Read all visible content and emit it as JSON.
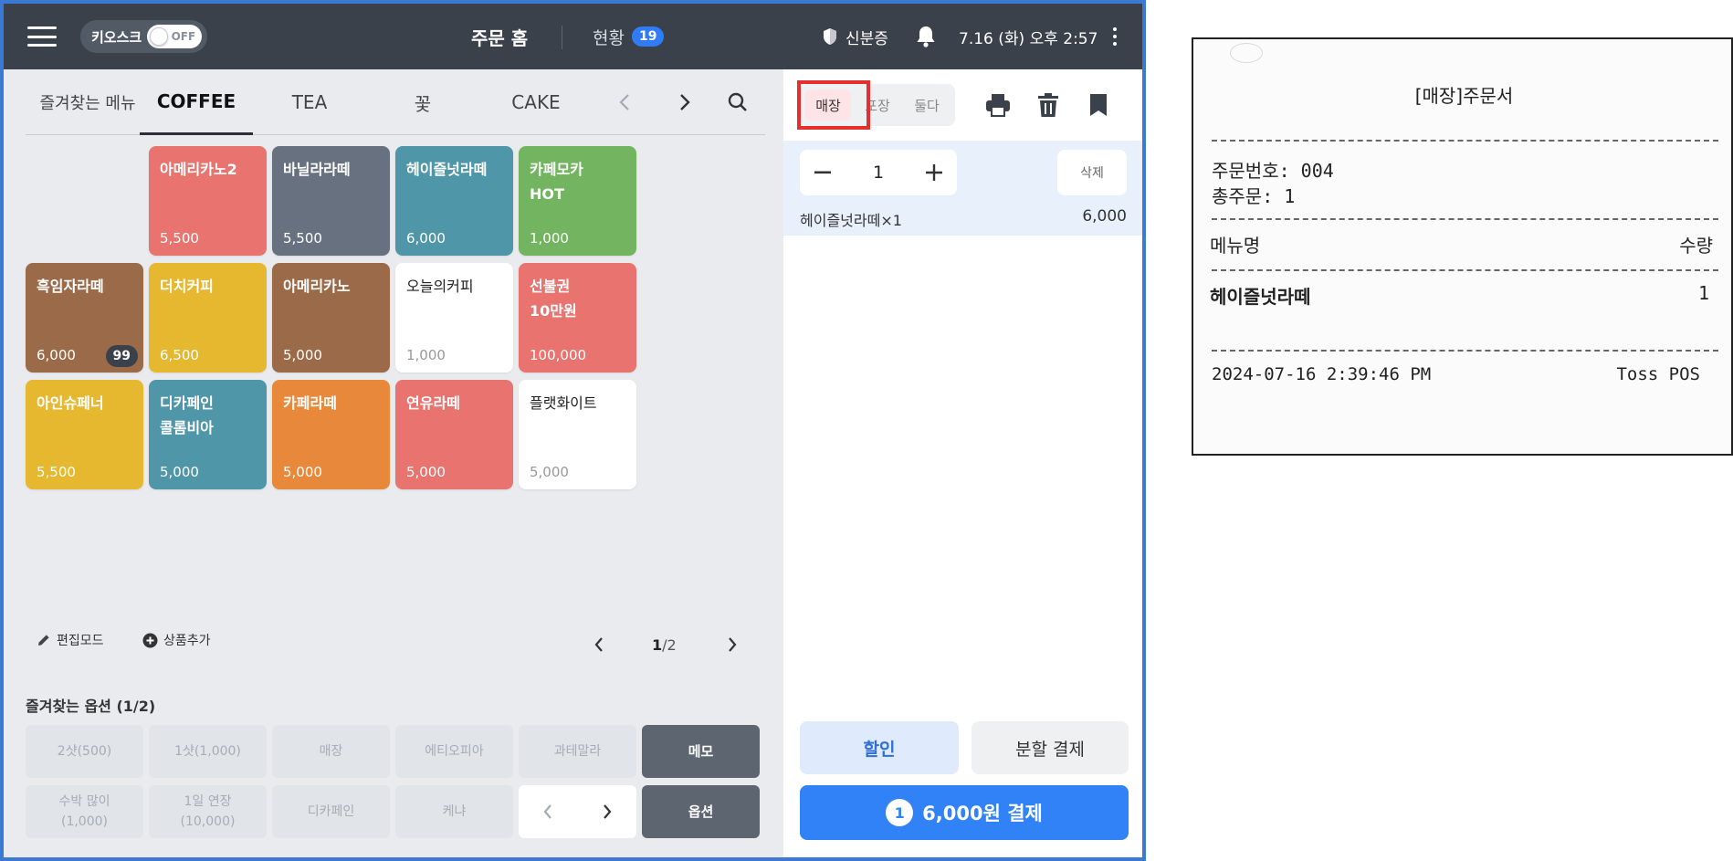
{
  "topbar": {
    "kiosk_label": "키오스크",
    "kiosk_state": "OFF",
    "order_home": "주문 홈",
    "status_label": "현황",
    "status_count": "19",
    "id_check": "신분증",
    "datetime": "7.16 (화) 오후 2:57"
  },
  "categories": {
    "favorites": "즐겨찾는 메뉴",
    "tabs": [
      "COFFEE",
      "TEA",
      "꽃",
      "CAKE"
    ],
    "active": "COFFEE"
  },
  "menu_tiles": [
    {
      "name": "아메리카노2",
      "price": "5,500",
      "color": "#e8736f"
    },
    {
      "name": "바닐라라떼",
      "price": "5,500",
      "color": "#68717f"
    },
    {
      "name": "헤이즐넛라떼",
      "price": "6,000",
      "color": "#4f97a8"
    },
    {
      "name": "카페모카\nHOT",
      "price": "1,000",
      "color": "#72b460"
    },
    {
      "name": "흑임자라떼",
      "price": "6,000",
      "color": "#9b6a48",
      "stock": "99"
    },
    {
      "name": "더치커피",
      "price": "6,500",
      "color": "#e5b82f"
    },
    {
      "name": "아메리카노",
      "price": "5,000",
      "color": "#9b6a48"
    },
    {
      "name": "오늘의커피",
      "price": "1,000",
      "color": "#ffffff"
    },
    {
      "name": "선불권\n10만원",
      "price": "100,000",
      "color": "#e8736f"
    },
    {
      "name": "아인슈페너",
      "price": "5,500",
      "color": "#e5b82f"
    },
    {
      "name": "디카페인\n콜롬비아",
      "price": "5,000",
      "color": "#4f97a8"
    },
    {
      "name": "카페라떼",
      "price": "5,000",
      "color": "#e8883a"
    },
    {
      "name": "연유라떼",
      "price": "5,000",
      "color": "#e8736f"
    },
    {
      "name": "플랫화이트",
      "price": "5,000",
      "color": "#ffffff"
    }
  ],
  "edit": {
    "edit_mode": "편집모드",
    "add_product": "상품추가",
    "page_current": "1",
    "page_total": "/2"
  },
  "options": {
    "title": "즐겨찾는 옵션 (1/2)",
    "row1": [
      "2샷(500)",
      "1샷(1,000)",
      "매장",
      "에티오피아",
      "과테말라"
    ],
    "row2": [
      "수박 많이\n(1,000)",
      "1일 연장\n(10,000)",
      "디카페인",
      "케냐"
    ],
    "memo": "메모",
    "option": "옵션"
  },
  "order_panel": {
    "types": [
      "매장",
      "포장",
      "둘다"
    ],
    "active_type": "매장",
    "quantity": "1",
    "delete_label": "삭제",
    "item_name": "헤이즐넛라떼×1",
    "item_price": "6,000",
    "discount_label": "할인",
    "split_label": "분할 결제",
    "pay_count": "1",
    "pay_label": "6,000원 결제"
  },
  "receipt": {
    "title": "[매장]주문서",
    "order_no_label": "주문번호: 004",
    "total_orders_label": "총주문: 1",
    "menu_header": "메뉴명",
    "qty_header": "수량",
    "item_name": "헤이즐넛라떼",
    "item_qty": "1",
    "timestamp": "2024-07-16 2:39:46 PM",
    "vendor": "Toss POS"
  },
  "colors": {
    "accent": "#3182f6",
    "frame": "#3b79d4",
    "topbar": "#3a414b",
    "highlight": "#e52e2e"
  }
}
